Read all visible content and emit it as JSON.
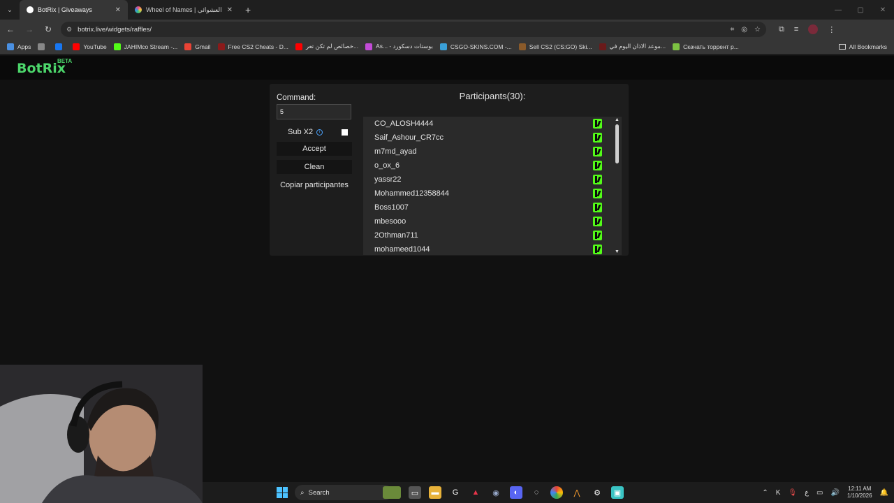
{
  "browser": {
    "tabs": [
      {
        "title": "BotRix | Giveaways",
        "active": true,
        "favicon_color": "#ffffff"
      },
      {
        "title": "Wheel of Names | سم العشوائي",
        "active": false,
        "favicon_color": "#e84b8a"
      }
    ],
    "url": "botrix.live/widgets/raffles/",
    "bookmarks": [
      {
        "label": "Apps",
        "color": "#4a90e2"
      },
      {
        "label": "",
        "color": "#888888"
      },
      {
        "label": "",
        "color": "#1877f2"
      },
      {
        "label": "YouTube",
        "color": "#ff0000"
      },
      {
        "label": "JAHIMco Stream -...",
        "color": "#53fc18"
      },
      {
        "label": "Gmail",
        "color": "#ea4335"
      },
      {
        "label": "Free CS2 Cheats - D...",
        "color": "#8b1a1a"
      },
      {
        "label": "خصائص لم تكن تعر...",
        "color": "#ff0000"
      },
      {
        "label": "As... - بوستات دسكورد",
        "color": "#c24bd6"
      },
      {
        "label": "CSGO-SKINS.COM -...",
        "color": "#3aa0d8"
      },
      {
        "label": "Sell CS2 (CS:GO) Ski...",
        "color": "#8a5a2a"
      },
      {
        "label": "موعد الاذان اليوم في...",
        "color": "#6a1a1a"
      },
      {
        "label": "Скачать торрент р...",
        "color": "#7cc242"
      }
    ],
    "all_bookmarks": "All Bookmarks"
  },
  "app": {
    "logo": "BotRix",
    "logo_badge": "BETA",
    "accent": "#4cd66b"
  },
  "raffle": {
    "command_label": "Command:",
    "command_value": "5",
    "sub_label": "Sub X2",
    "sub_checked": false,
    "accept_label": "Accept",
    "clean_label": "Clean",
    "copy_label": "Copiar participantes",
    "participants_title": "Participants(30):",
    "participants": [
      "CO_ALOSH4444",
      "Saif_Ashour_CR7cc",
      "m7md_ayad",
      "o_ox_6",
      "yassr22",
      "Mohammed12358844",
      "Boss1007",
      "mbesooo",
      "2Othman711",
      "mohameed1044"
    ]
  },
  "taskbar": {
    "search_label": "Search",
    "time": "12:11 AM",
    "date": "1/10/2026",
    "lang": "ع"
  }
}
